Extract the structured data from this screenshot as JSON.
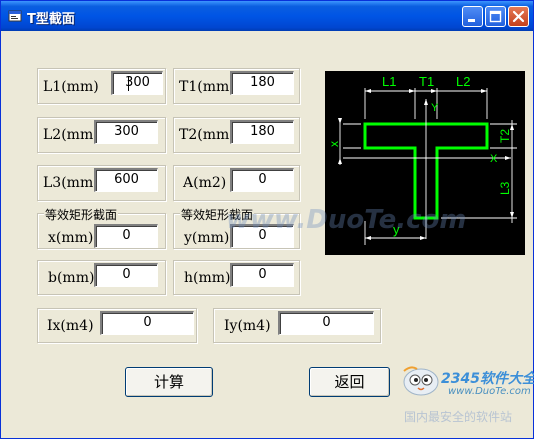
{
  "window": {
    "title": "T型截面"
  },
  "fields": {
    "l1": {
      "label": "L1(mm)",
      "value": "300"
    },
    "t1": {
      "label": "T1(mm)",
      "value": "180"
    },
    "l2": {
      "label": "L2(mm)",
      "value": "300"
    },
    "t2": {
      "label": "T2(mm)",
      "value": "180"
    },
    "l3": {
      "label": "L3(mm)",
      "value": "600"
    },
    "a": {
      "label": "A(m2)",
      "value": "0"
    },
    "x": {
      "caption": "等效矩形截面",
      "label": "x(mm)",
      "value": "0"
    },
    "y": {
      "caption": "等效矩形截面",
      "label": "y(mm)",
      "value": "0"
    },
    "b": {
      "label": "b(mm)",
      "value": "0"
    },
    "h": {
      "label": "h(mm)",
      "value": "0"
    },
    "ix": {
      "label": "Ix(m4)",
      "value": "0"
    },
    "iy": {
      "label": "Iy(m4)",
      "value": "0"
    }
  },
  "buttons": {
    "calc": "计算",
    "back": "返回"
  },
  "diagram": {
    "labels": {
      "l1": "L1",
      "t1": "T1",
      "l2": "L2",
      "t2": "T2",
      "l3": "L3",
      "x": "x",
      "y": "y",
      "x_axis": "X",
      "y_axis": "Y"
    },
    "colors": {
      "shape": "#00ff00",
      "lines": "#ffffff",
      "background": "#000000"
    }
  },
  "watermarks": {
    "center": "www.DuoTe.com",
    "logo": "2345软件大全",
    "logo_url": "www.DuoTe.com",
    "slogan": "国内最安全的软件站"
  }
}
